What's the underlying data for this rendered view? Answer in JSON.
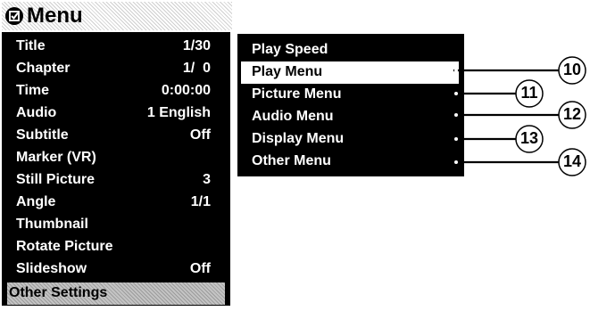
{
  "header": {
    "title": "Menu"
  },
  "left_menu": {
    "items": [
      {
        "label": "Title",
        "value": "1/30"
      },
      {
        "label": "Chapter",
        "value": "1/  0"
      },
      {
        "label": "Time",
        "value": "0:00:00"
      },
      {
        "label": "Audio",
        "value": "1 English"
      },
      {
        "label": "Subtitle",
        "value": "Off"
      },
      {
        "label": "Marker (VR)",
        "value": ""
      },
      {
        "label": "Still Picture",
        "value": "3"
      },
      {
        "label": "Angle",
        "value": "1/1"
      },
      {
        "label": "Thumbnail",
        "value": ""
      },
      {
        "label": "Rotate Picture",
        "value": ""
      },
      {
        "label": "Slideshow",
        "value": "Off"
      },
      {
        "label": "Other Settings",
        "value": ""
      }
    ],
    "selected_index": 11
  },
  "submenu": {
    "items": [
      {
        "label": "Play Speed"
      },
      {
        "label": "Play Menu"
      },
      {
        "label": "Picture Menu"
      },
      {
        "label": "Audio Menu"
      },
      {
        "label": "Display Menu"
      },
      {
        "label": "Other Menu"
      }
    ],
    "selected_index": 1
  },
  "callouts": [
    "10",
    "11",
    "12",
    "13",
    "14"
  ],
  "colors": {
    "panel": "#000000",
    "text": "#ffffff",
    "highlight": "#ffffff"
  },
  "icons": {
    "menu": "checkmark-circle-icon"
  }
}
